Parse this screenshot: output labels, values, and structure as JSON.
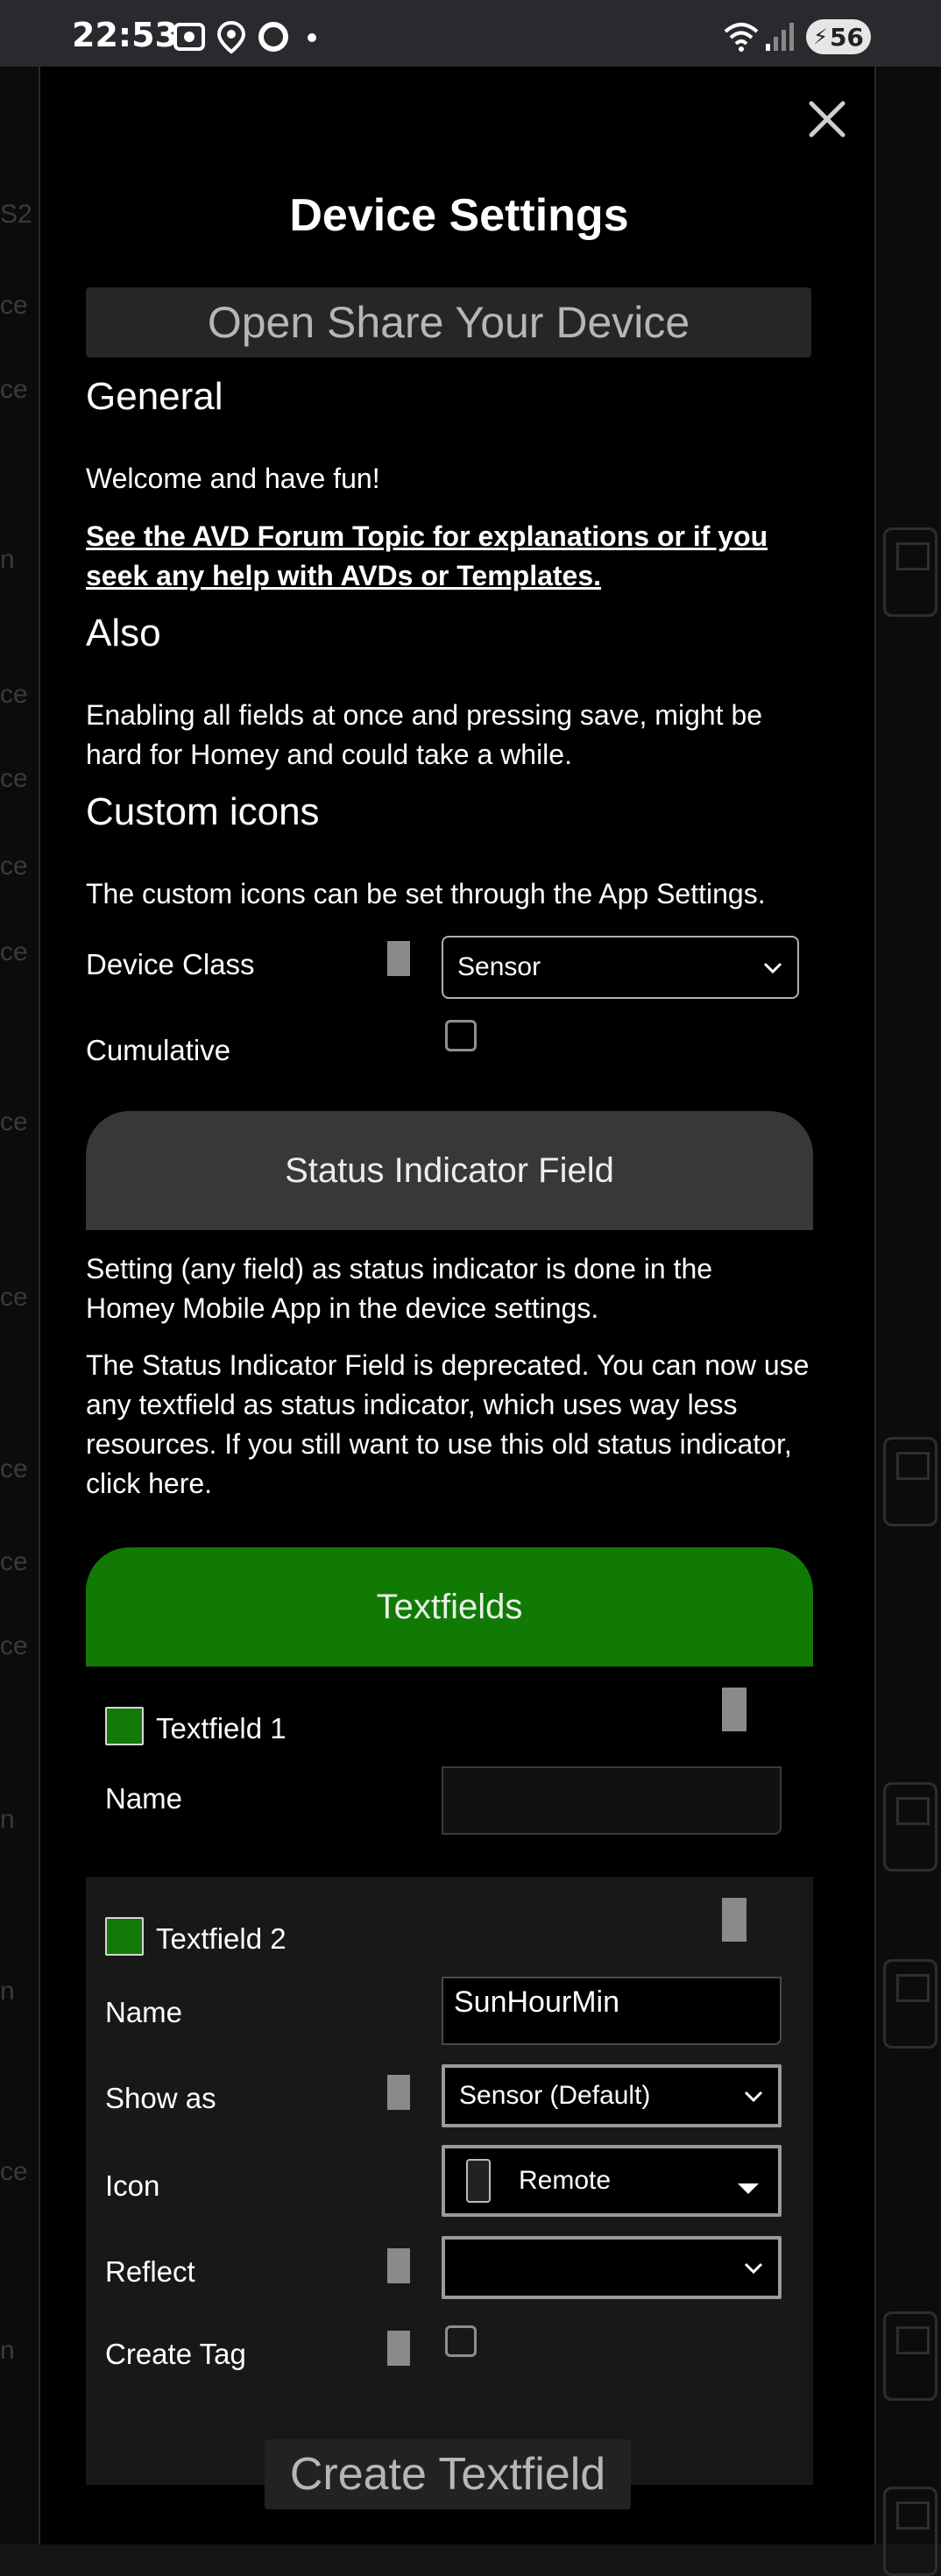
{
  "status_bar": {
    "time": "22:53",
    "battery": "56"
  },
  "background_peeks": [
    "S2",
    "ce",
    "ce",
    "n",
    "ce",
    "ce",
    "ce",
    "ce",
    "ce",
    "ce",
    "ce",
    "ce",
    "ce",
    "n",
    "n",
    "ce",
    "n"
  ],
  "modal": {
    "title": "Device Settings",
    "share_button": "Open Share Your Device",
    "general": {
      "heading": "General",
      "welcome": "Welcome and have fun!",
      "forum_link": "See the AVD Forum Topic for explanations or if you seek any help with AVDs or Templates."
    },
    "also": {
      "heading": "Also",
      "text": "Enabling all fields at once and pressing save, might be hard for Homey and could take a while."
    },
    "custom_icons": {
      "heading": "Custom icons",
      "text": "The custom icons can be set through the App Settings."
    },
    "device_class": {
      "label": "Device Class",
      "value": "Sensor"
    },
    "cumulative": {
      "label": "Cumulative"
    },
    "status_indicator": {
      "heading": "Status Indicator Field",
      "text1": "Setting (any field) as status indicator is done in the Homey Mobile App in the device settings.",
      "text2": "The Status Indicator Field is deprecated. You can now use any textfield as status indicator, which uses way less resources. If you still want to use this old status indicator, click here."
    },
    "textfields": {
      "heading": "Textfields",
      "field1": {
        "title": "Textfield 1",
        "name_label": "Name",
        "name_value": ""
      },
      "field2": {
        "title": "Textfield 2",
        "name_label": "Name",
        "name_value": "SunHourMin",
        "show_as_label": "Show as",
        "show_as_value": "Sensor (Default)",
        "icon_label": "Icon",
        "icon_value": "Remote",
        "reflect_label": "Reflect",
        "reflect_value": "",
        "create_tag_label": "Create Tag"
      }
    },
    "create_button": "Create Textfield"
  },
  "colors": {
    "accent_green": "#117a04",
    "section_gray": "#383838",
    "modal_bg": "#000000"
  }
}
